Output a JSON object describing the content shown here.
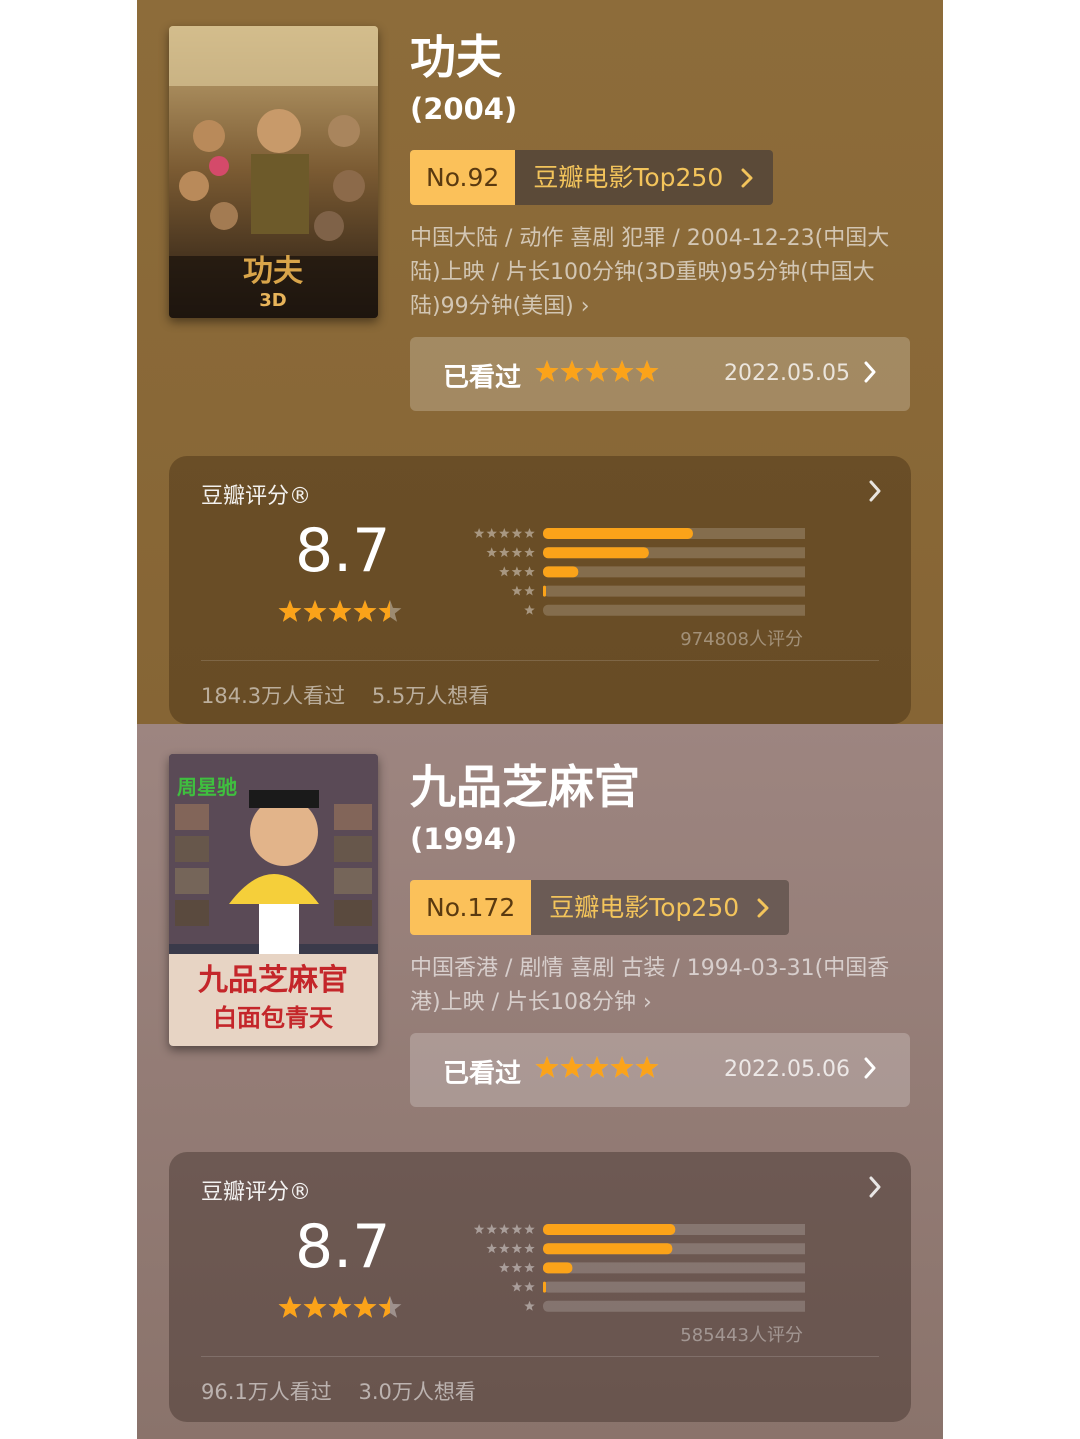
{
  "movies": [
    {
      "title": "功夫",
      "year": "(2004)",
      "rank_no": "No.92",
      "rank_list": "豆瓣电影Top250",
      "meta": "中国大陆 / 动作 喜剧 犯罪 / 2004-12-23(中国大陆)上映 / 片长100分钟(3D重映)95分钟(中国大陆)99分钟(美国) ›",
      "watched_label": "已看过",
      "watched_stars": 5,
      "watched_date": "2022.05.05",
      "rating_label": "豆瓣评分®",
      "score": "8.7",
      "score_stars": 4.5,
      "distribution": [
        0.51,
        0.36,
        0.12,
        0.01,
        0.0
      ],
      "voters": "974808人评分",
      "seen": "184.3万人看过",
      "want": "5.5万人想看"
    },
    {
      "title": "九品芝麻官",
      "year": "(1994)",
      "rank_no": "No.172",
      "rank_list": "豆瓣电影Top250",
      "meta": "中国香港 / 剧情 喜剧 古装 / 1994-03-31(中国香港)上映 / 片长108分钟 ›",
      "watched_label": "已看过",
      "watched_stars": 5,
      "watched_date": "2022.05.06",
      "rating_label": "豆瓣评分®",
      "score": "8.7",
      "score_stars": 4.5,
      "distribution": [
        0.45,
        0.44,
        0.1,
        0.01,
        0.0
      ],
      "voters": "585443人评分",
      "seen": "96.1万人看过",
      "want": "3.0万人想看"
    }
  ],
  "colors": {
    "star": "#fba319",
    "bar_fill": "#fba319",
    "bar_track": "rgba(255,255,255,0.18)"
  }
}
